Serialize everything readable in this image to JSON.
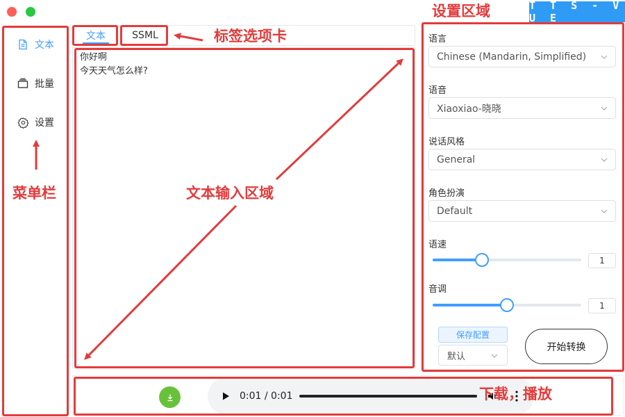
{
  "brand": "T T S - V U E",
  "sidebar": {
    "items": [
      {
        "label": "文本",
        "icon": "document-icon",
        "active": true
      },
      {
        "label": "批量",
        "icon": "layers-icon",
        "active": false
      },
      {
        "label": "设置",
        "icon": "gear-icon",
        "active": false
      }
    ]
  },
  "tabs": [
    {
      "label": "文本",
      "active": true
    },
    {
      "label": "SSML",
      "active": false
    }
  ],
  "editor": {
    "lines": [
      "你好啊",
      "今天天气怎么样?"
    ]
  },
  "settings": {
    "language_label": "语言",
    "language_value": "Chinese (Mandarin, Simplified)",
    "voice_label": "语音",
    "voice_value": "Xiaoxiao-晓晓",
    "style_label": "说话风格",
    "style_value": "General",
    "role_label": "角色扮演",
    "role_value": "Default",
    "rate_label": "语速",
    "rate_value": "1",
    "rate_fraction": 0.33,
    "pitch_label": "音调",
    "pitch_value": "1",
    "pitch_fraction": 0.5,
    "save_label": "保存配置",
    "preset_value": "默认",
    "convert_label": "开始转换"
  },
  "player": {
    "time": "0:01 / 0:01"
  },
  "annotations": {
    "menu": "菜单栏",
    "tabs": "标签选项卡",
    "input": "文本输入区域",
    "settings": "设置区域",
    "download": "下载，播放"
  },
  "colors": {
    "accent": "#409eff",
    "brand": "#2f9bf5",
    "annotation": "#e33b3b",
    "download": "#67c23a"
  }
}
